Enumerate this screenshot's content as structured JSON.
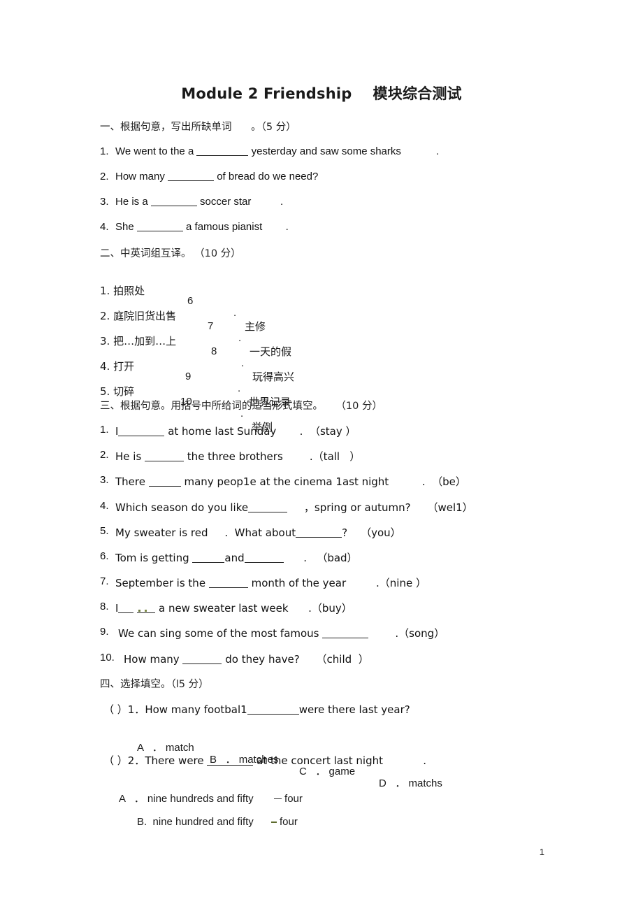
{
  "document": {
    "title": "Module 2 Friendship    模块综合测试",
    "page_number": "1"
  },
  "section1": {
    "heading": "一、根据句意，写出所缺单词      。（5 分）",
    "items": [
      {
        "num": "1.",
        "before": "We went to the a ",
        "after": " yesterday and saw some sharks            ."
      },
      {
        "num": "2.",
        "before": "How many ",
        "after": " of bread do we need?"
      },
      {
        "num": "3.",
        "before": "He is a ",
        "after": " soccer star          ."
      },
      {
        "num": "4.",
        "before": "She ",
        "after": " a famous pianist        ."
      }
    ]
  },
  "section2": {
    "heading": "二、中英词组互译。 （10 分）",
    "rows": [
      {
        "left_num": "1.",
        "left": "拍照处",
        "right_num": "6",
        "dot": ".",
        "right": "主修"
      },
      {
        "left_num": "2.",
        "left": "庭院旧货出售",
        "right_num": "7",
        "dot": ".",
        "right": "一天的假"
      },
      {
        "left_num": "3.",
        "left": "把…加到…上",
        "right_num": "8",
        "dot": ".",
        "right": "玩得高兴"
      },
      {
        "left_num": "4.",
        "left": "打开",
        "right_num": "9",
        "dot": ".",
        "right": "世界记录"
      },
      {
        "left_num": "5.",
        "left": "切碎",
        "right_num": "10",
        "dot": ".",
        "right": "举例"
      }
    ]
  },
  "section3": {
    "heading": "三、根据句意。用括号中所给词的适当形式填空。    （10 分）",
    "items": [
      {
        "num": "1.",
        "before": "I",
        "after": " at home last Sunday       .  （stay ）"
      },
      {
        "num": "2.",
        "before": "He is ",
        "after": " the three brothers        .（tall   ）"
      },
      {
        "num": "3.",
        "before": "There ",
        "after": " many peop1e at the cinema 1ast night          .  （be）"
      },
      {
        "num": "4.",
        "before": "Which season do you like",
        "after": "     ，spring or autumn?     （wel1）"
      },
      {
        "num": "5.",
        "before": "My sweater is red     .  What about",
        "after": "?    （you）"
      },
      {
        "num": "6.",
        "before": "Tom is getting ",
        "mid": "and",
        "after": "      .   （bad）"
      },
      {
        "num": "7.",
        "before": "September is the ",
        "after": " month of the year         .（nine ）"
      },
      {
        "num": "8.",
        "before": "I",
        "after": " a new sweater last week      .（buy）"
      },
      {
        "num": "9.",
        "before": "We can sing some of the most famous ",
        "after": "        .（song）"
      },
      {
        "num": "10.",
        "before": "How many ",
        "after": " do they have?     （child  ）"
      }
    ]
  },
  "section4": {
    "heading": "四、选择填空。（l5 分）",
    "questions": [
      {
        "marker": "（ ）1．",
        "before": "How many footbal1",
        "after": "were there last year?",
        "options": [
          {
            "letter": "A",
            "dot": "．",
            "text": "match"
          },
          {
            "letter": "B",
            "dot": "．",
            "text": "matches"
          },
          {
            "letter": "C",
            "dot": "．",
            "text": "game"
          },
          {
            "letter": "D",
            "dot": "．",
            "text": "matchs"
          }
        ]
      },
      {
        "marker": "（ ）2．",
        "before": "There were ",
        "after": " at the concert last night            .",
        "options": [
          {
            "letter": "A",
            "dot": "．",
            "text": "nine hundreds and fifty",
            "suffix": "four"
          },
          {
            "letter": "B.",
            "dot": "",
            "text": "nine hundred and fifty",
            "suffix": "four"
          }
        ]
      }
    ]
  }
}
